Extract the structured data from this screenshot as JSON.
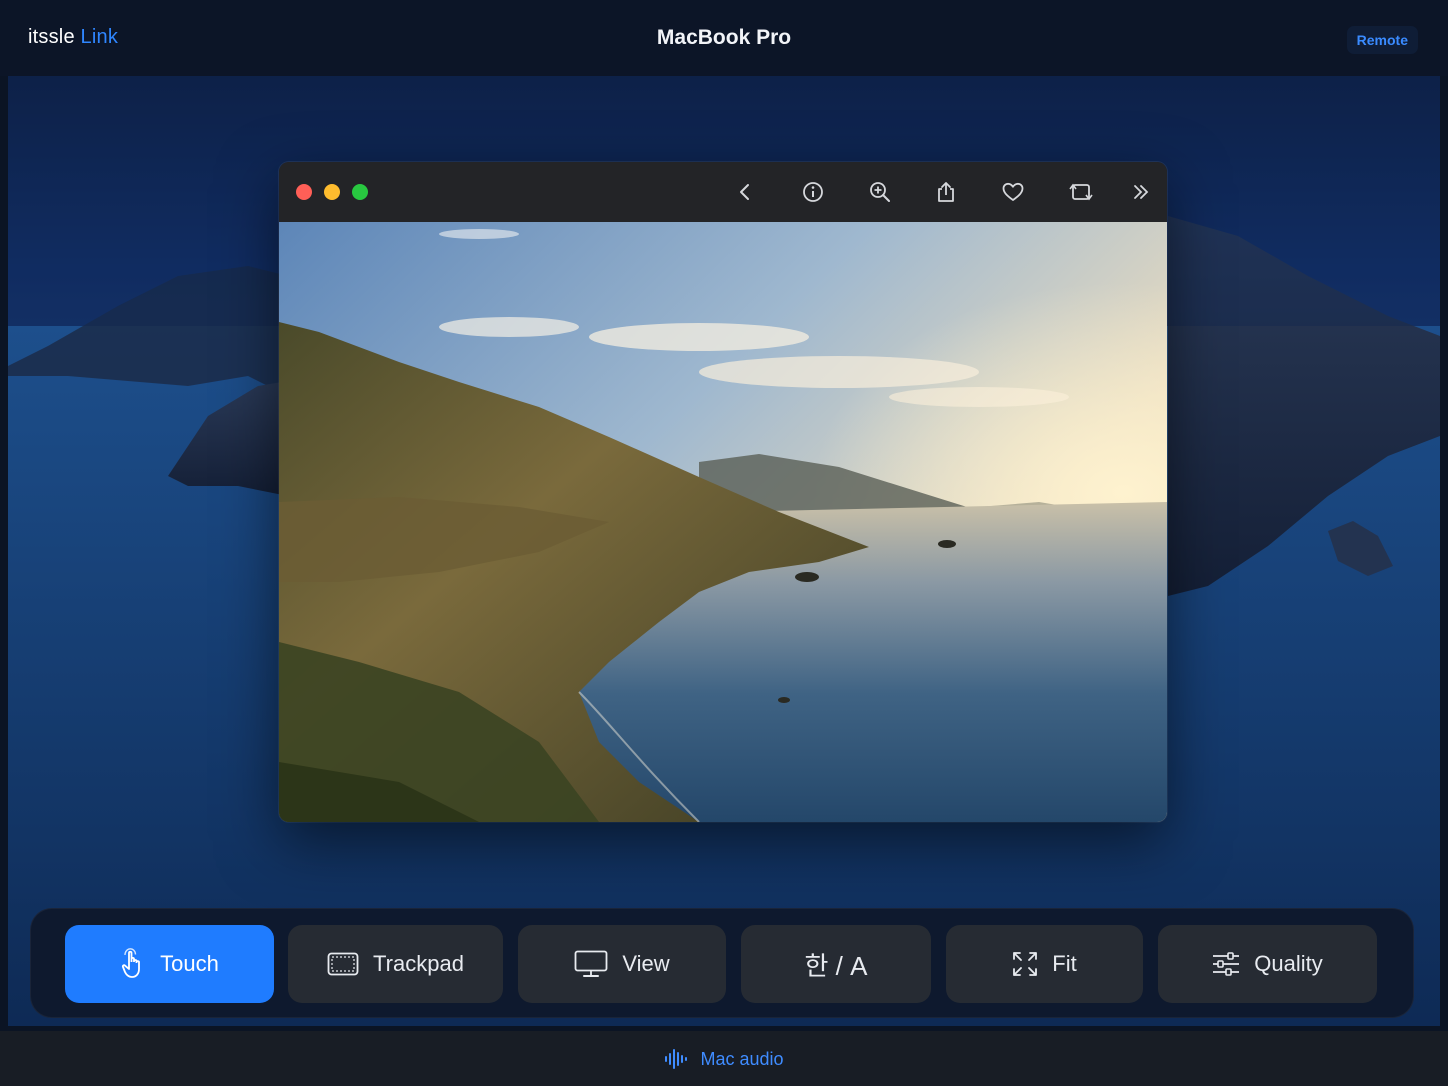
{
  "header": {
    "brand_part1": "itssle",
    "brand_part2": "Link",
    "device_name": "MacBook Pro",
    "remote_label": "Remote"
  },
  "window": {
    "traffic_lights": [
      "close",
      "minimize",
      "zoom"
    ],
    "toolbar_icons": [
      "back-chevron-icon",
      "info-icon",
      "zoom-in-icon",
      "share-icon",
      "favorite-heart-icon",
      "rotate-icon",
      "more-chevrons-icon"
    ],
    "image_subject": "coastal cliffs at sunset"
  },
  "toolbar": {
    "touch": "Touch",
    "trackpad": "Trackpad",
    "view": "View",
    "input_lang": "한 / A",
    "fit": "Fit",
    "quality": "Quality",
    "active": "touch"
  },
  "footer": {
    "audio_label": "Mac audio"
  },
  "colors": {
    "accent": "#1f7cff",
    "brand_link": "#2f86ff",
    "background": "#0b1424"
  }
}
